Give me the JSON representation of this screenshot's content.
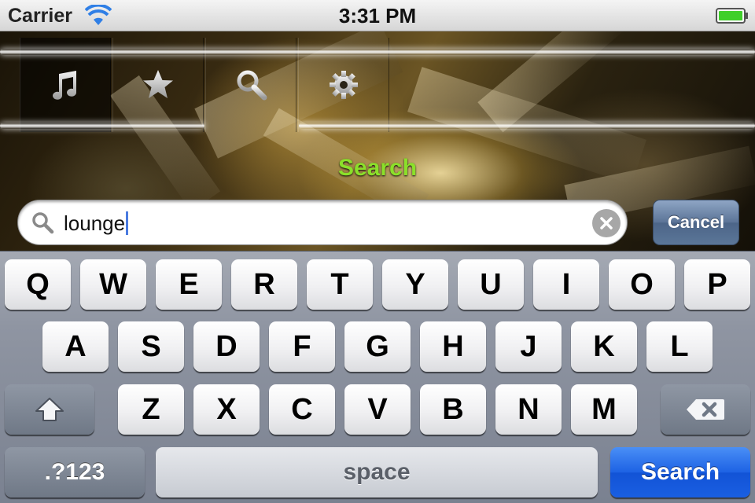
{
  "status_bar": {
    "carrier": "Carrier",
    "time": "3:31 PM",
    "wifi_icon": "wifi-icon",
    "battery_icon": "battery-full-icon",
    "battery_color": "#3fcf2a"
  },
  "tab_bar": {
    "tabs": [
      {
        "icon": "music-note-icon",
        "selected": true
      },
      {
        "icon": "star-icon",
        "selected": false
      },
      {
        "icon": "magnifier-icon",
        "selected": false
      },
      {
        "icon": "gear-icon",
        "selected": false
      }
    ]
  },
  "screen": {
    "title": "Search",
    "title_color": "#8be02a"
  },
  "search": {
    "value": "lounge",
    "cancel_label": "Cancel"
  },
  "keyboard": {
    "row1": [
      "Q",
      "W",
      "E",
      "R",
      "T",
      "Y",
      "U",
      "I",
      "O",
      "P"
    ],
    "row2": [
      "A",
      "S",
      "D",
      "F",
      "G",
      "H",
      "J",
      "K",
      "L"
    ],
    "row3": [
      "Z",
      "X",
      "C",
      "V",
      "B",
      "N",
      "M"
    ],
    "numbers_label": ".?123",
    "space_label": "space",
    "return_label": "Search",
    "return_color": "#1d62e4"
  }
}
